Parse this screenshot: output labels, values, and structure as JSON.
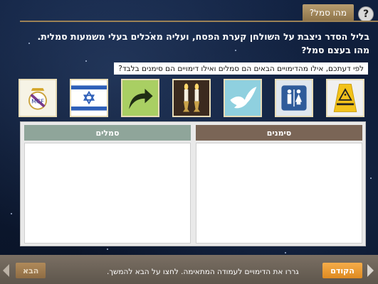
{
  "header": {
    "help_glyph": "?",
    "title": "מהו סמל?"
  },
  "question": {
    "line1": "בליל הסדר ניצבת על השולחן קערת הפסח, ועליה מאכלים בעלי משמעות סמלית.",
    "line2": "מהו בעצם סמל?"
  },
  "prompt": "לפי דעתכם, אילו מהדימויים הבאים הם סמלים ואילו דימויים הם סימנים בלבד?",
  "cards": [
    {
      "icon": "real-madrid-crest-icon"
    },
    {
      "icon": "israel-flag-icon"
    },
    {
      "icon": "curved-arrow-icon"
    },
    {
      "icon": "shabbat-candles-icon"
    },
    {
      "icon": "dove-icon"
    },
    {
      "icon": "restroom-sign-icon"
    },
    {
      "icon": "wet-floor-sign-icon"
    }
  ],
  "table": {
    "symbols_header": "סמלים",
    "signs_header": "סימנים",
    "symbols_color": "#8fa59a",
    "signs_color": "#7a6556"
  },
  "footer": {
    "next_label": "הבא",
    "prev_label": "הקודם",
    "instruction": "גררו את הדימויים לעמודה המתאימה. לחצו על הבא להמשך."
  }
}
